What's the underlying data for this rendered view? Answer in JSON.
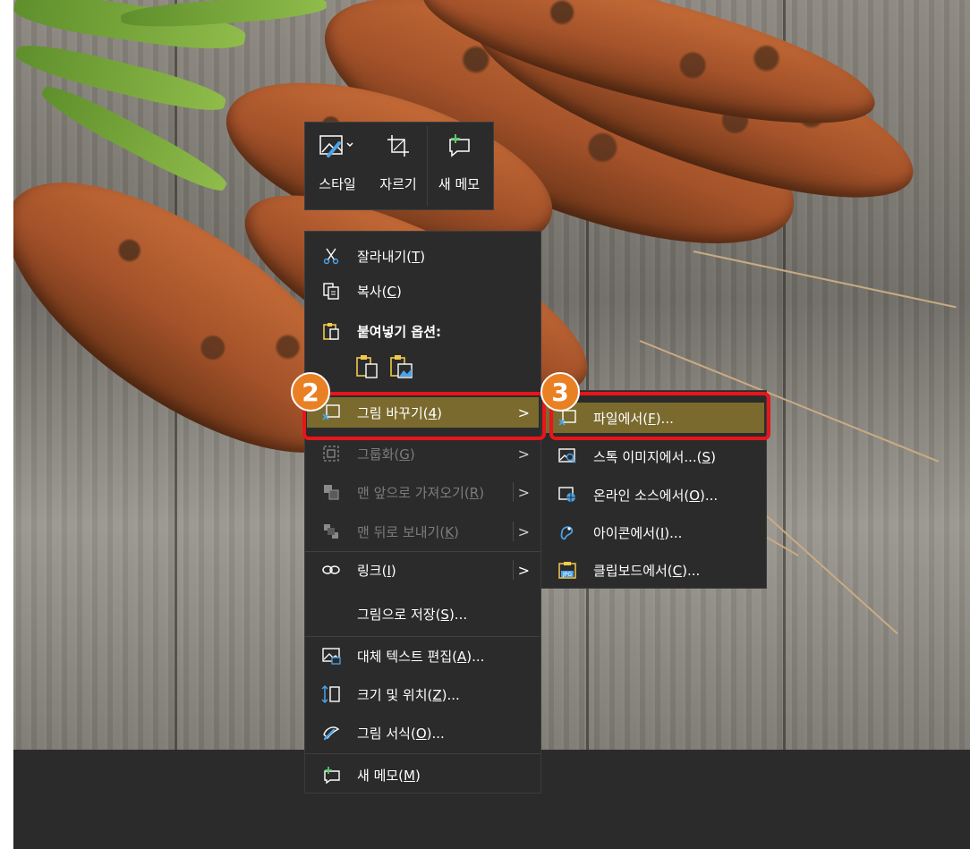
{
  "mini_toolbar": {
    "style": {
      "label": "스타일",
      "icon": "picture-style-icon"
    },
    "crop": {
      "label": "자르기",
      "icon": "crop-icon"
    },
    "new_comment": {
      "label": "새 메모",
      "icon": "new-comment-icon"
    }
  },
  "context_menu": {
    "cut": {
      "label": "잘라내기(",
      "key": "T",
      "tail": ")"
    },
    "copy": {
      "label": "복사(",
      "key": "C",
      "tail": ")"
    },
    "paste_options": {
      "label": "붙여넣기 옵션:"
    },
    "change_picture": {
      "label": "그림 바꾸기(",
      "key": "4",
      "tail": ")"
    },
    "group": {
      "label": "그룹화(",
      "key": "G",
      "tail": ")"
    },
    "bring_to_front": {
      "label": "맨 앞으로 가져오기(",
      "key": "R",
      "tail": ")"
    },
    "send_to_back": {
      "label": "맨 뒤로 보내기(",
      "key": "K",
      "tail": ")"
    },
    "link": {
      "label": "링크(",
      "key": "I",
      "tail": ")"
    },
    "save_as_picture": {
      "label": "그림으로 저장(",
      "key": "S",
      "tail": ")..."
    },
    "edit_alt_text": {
      "label": "대체 텍스트 편집(",
      "key": "A",
      "tail": ")..."
    },
    "size_position": {
      "label": "크기 및 위치(",
      "key": "Z",
      "tail": ")..."
    },
    "format_picture": {
      "label": "그림 서식(",
      "key": "O",
      "tail": ")..."
    },
    "new_comment": {
      "label": "새 메모(",
      "key": "M",
      "tail": ")"
    }
  },
  "sub_menu": {
    "from_file": {
      "label": "파일에서(",
      "key": "F",
      "tail": ")..."
    },
    "from_stock": {
      "label": "스톡 이미지에서...(",
      "key": "S",
      "tail": ")"
    },
    "from_online": {
      "label": "온라인 소스에서(",
      "key": "O",
      "tail": ")..."
    },
    "from_icons": {
      "label": "아이콘에서(",
      "key": "I",
      "tail": ")..."
    },
    "from_clipboard": {
      "label": "클립보드에서(",
      "key": "C",
      "tail": ")..."
    }
  },
  "badges": {
    "step2": "2",
    "step3": "3"
  },
  "arrow_glyph": ">",
  "colors": {
    "highlight": "#7a6a2e",
    "callout_border": "#e8151b",
    "badge": "#e98024",
    "menu_bg": "#2b2b2b"
  }
}
